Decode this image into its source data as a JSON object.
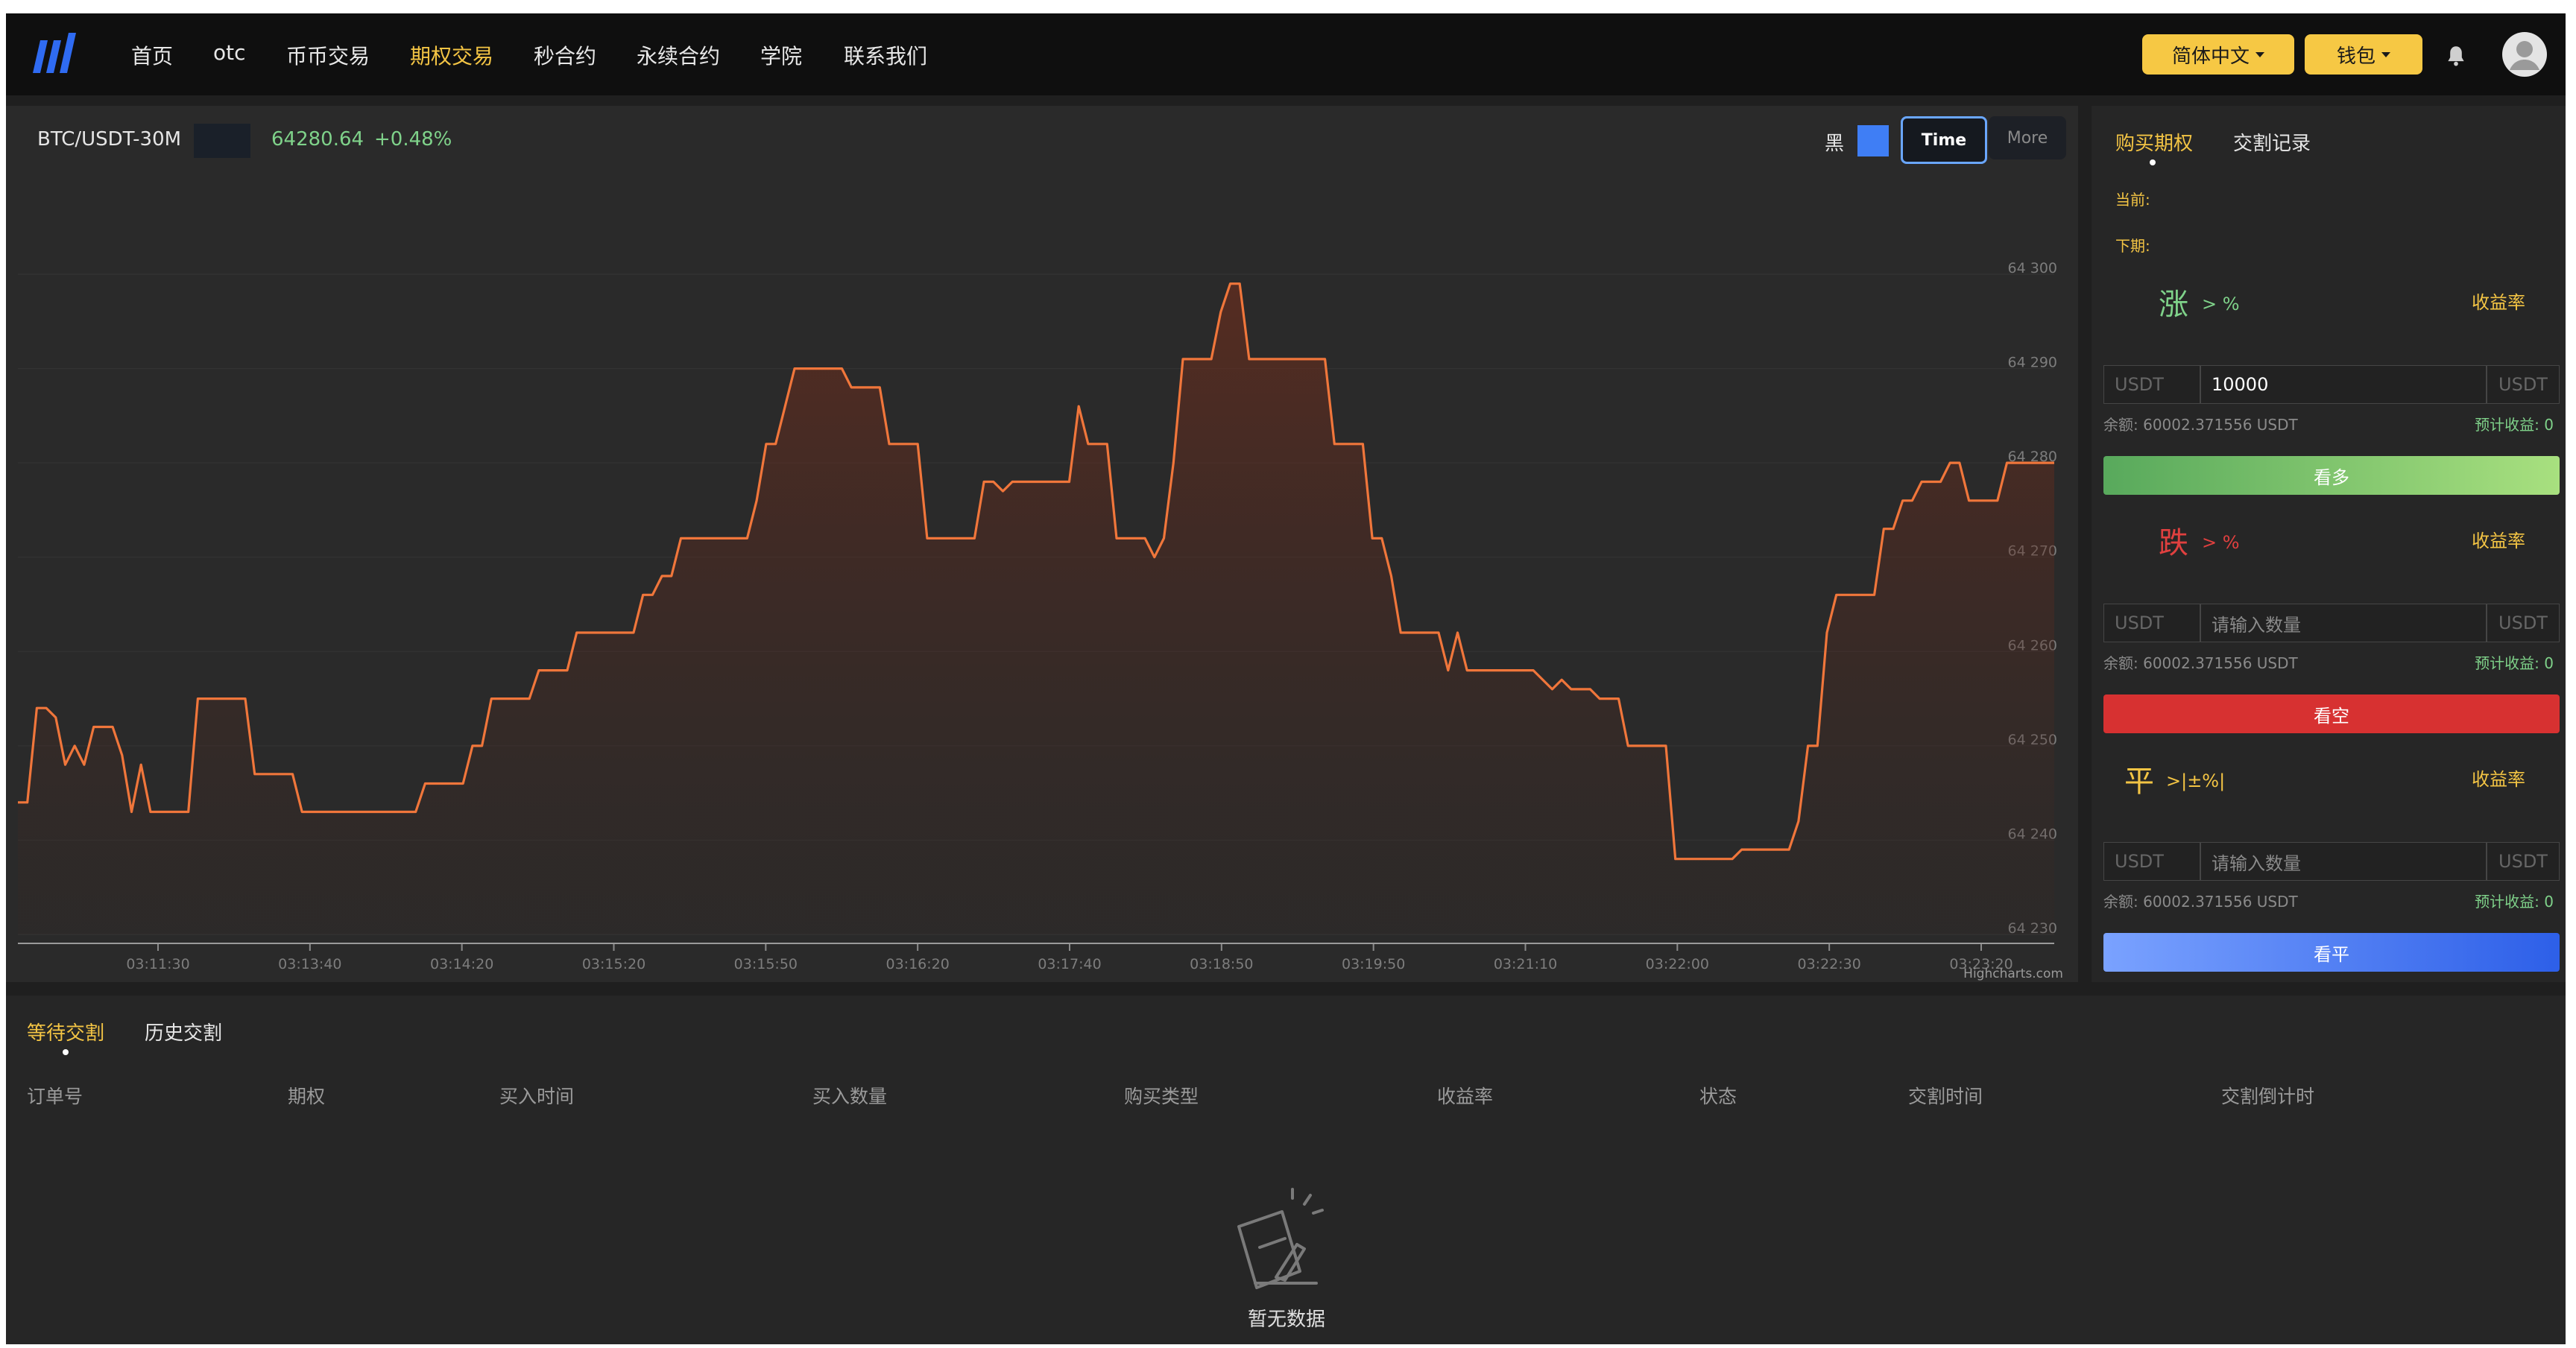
{
  "nav": {
    "links": [
      "首页",
      "otc",
      "币币交易",
      "期权交易",
      "秒合约",
      "永续合约",
      "学院",
      "联系我们"
    ],
    "active_index": 3,
    "language_label": "简体中文",
    "wallet_label": "钱包"
  },
  "ticker": {
    "symbol": "BTC/USDT-30M",
    "price": "64280.64",
    "change": "+0.48%",
    "theme_label": "黑",
    "time_button": "Time",
    "more_button": "More",
    "credit": "Highcharts.com"
  },
  "chart_data": {
    "type": "area",
    "x_ticks": [
      "03:11:30",
      "03:13:40",
      "03:14:20",
      "03:15:20",
      "03:15:50",
      "03:16:20",
      "03:17:40",
      "03:18:50",
      "03:19:50",
      "03:21:10",
      "03:22:00",
      "03:22:30",
      "03:23:20"
    ],
    "y_ticks": [
      "64 300",
      "64 290",
      "64 280",
      "64 270",
      "64 260",
      "64 250",
      "64 240",
      "64 230"
    ],
    "ylim": [
      64230,
      64300
    ],
    "values": [
      64244,
      64244,
      64254,
      64254,
      64253,
      64248,
      64250,
      64248,
      64252,
      64252,
      64252,
      64249,
      64243,
      64248,
      64243,
      64243,
      64243,
      64243,
      64243,
      64255,
      64255,
      64255,
      64255,
      64255,
      64255,
      64247,
      64247,
      64247,
      64247,
      64247,
      64243,
      64243,
      64243,
      64243,
      64243,
      64243,
      64243,
      64243,
      64243,
      64243,
      64243,
      64243,
      64243,
      64246,
      64246,
      64246,
      64246,
      64246,
      64250,
      64250,
      64255,
      64255,
      64255,
      64255,
      64255,
      64258,
      64258,
      64258,
      64258,
      64262,
      64262,
      64262,
      64262,
      64262,
      64262,
      64262,
      64266,
      64266,
      64268,
      64268,
      64272,
      64272,
      64272,
      64272,
      64272,
      64272,
      64272,
      64272,
      64276,
      64282,
      64282,
      64286,
      64290,
      64290,
      64290,
      64290,
      64290,
      64290,
      64288,
      64288,
      64288,
      64288,
      64282,
      64282,
      64282,
      64282,
      64272,
      64272,
      64272,
      64272,
      64272,
      64272,
      64278,
      64278,
      64277,
      64278,
      64278,
      64278,
      64278,
      64278,
      64278,
      64278,
      64286,
      64282,
      64282,
      64282,
      64272,
      64272,
      64272,
      64272,
      64270,
      64272,
      64280,
      64291,
      64291,
      64291,
      64291,
      64296,
      64299,
      64299,
      64291,
      64291,
      64291,
      64291,
      64291,
      64291,
      64291,
      64291,
      64291,
      64282,
      64282,
      64282,
      64282,
      64272,
      64272,
      64268,
      64262,
      64262,
      64262,
      64262,
      64262,
      64258,
      64262,
      64258,
      64258,
      64258,
      64258,
      64258,
      64258,
      64258,
      64258,
      64257,
      64256,
      64257,
      64256,
      64256,
      64256,
      64255,
      64255,
      64255,
      64250,
      64250,
      64250,
      64250,
      64250,
      64238,
      64238,
      64238,
      64238,
      64238,
      64238,
      64238,
      64239,
      64239,
      64239,
      64239,
      64239,
      64239,
      64242,
      64250,
      64250,
      64262,
      64266,
      64266,
      64266,
      64266,
      64266,
      64273,
      64273,
      64276,
      64276,
      64278,
      64278,
      64278,
      64280,
      64280,
      64276,
      64276,
      64276,
      64276,
      64280,
      64280,
      64280,
      64280,
      64280,
      64280
    ]
  },
  "right": {
    "tab_buy": "购买期权",
    "tab_records": "交割记录",
    "current_label": "当前:",
    "next_label": "下期:",
    "rise": {
      "char": "涨",
      "cmp": "> %",
      "yield_label": "收益率",
      "currency": "USDT",
      "value": "10000",
      "placeholder": "请输入数量",
      "balance": "余额:  60002.371556 USDT",
      "estimate": "预计收益:  0",
      "button": "看多"
    },
    "fall": {
      "char": "跌",
      "cmp": "> %",
      "yield_label": "收益率",
      "currency": "USDT",
      "value": "",
      "placeholder": "请输入数量",
      "balance": "余额:  60002.371556 USDT",
      "estimate": "预计收益:  0",
      "button": "看空"
    },
    "flat": {
      "char": "平",
      "cmp": ">|±%|",
      "yield_label": "收益率",
      "currency": "USDT",
      "value": "",
      "placeholder": "请输入数量",
      "balance": "余额:  60002.371556 USDT",
      "estimate": "预计收益:  0",
      "button": "看平"
    }
  },
  "orders": {
    "tab_pending": "等待交割",
    "tab_history": "历史交割",
    "columns": [
      "订单号",
      "期权",
      "买入时间",
      "买入数量",
      "购买类型",
      "收益率",
      "状态",
      "交割时间",
      "交割倒计时"
    ],
    "empty_text": "暂无数据"
  },
  "colors": {
    "accent": "#f3c444",
    "line": "#f0763b",
    "rise": "#7fd28a",
    "fall": "#e0403f",
    "buy_button": "#6ec06e",
    "sell_button": "#d73131",
    "flat_button": "#3f6ff0"
  }
}
